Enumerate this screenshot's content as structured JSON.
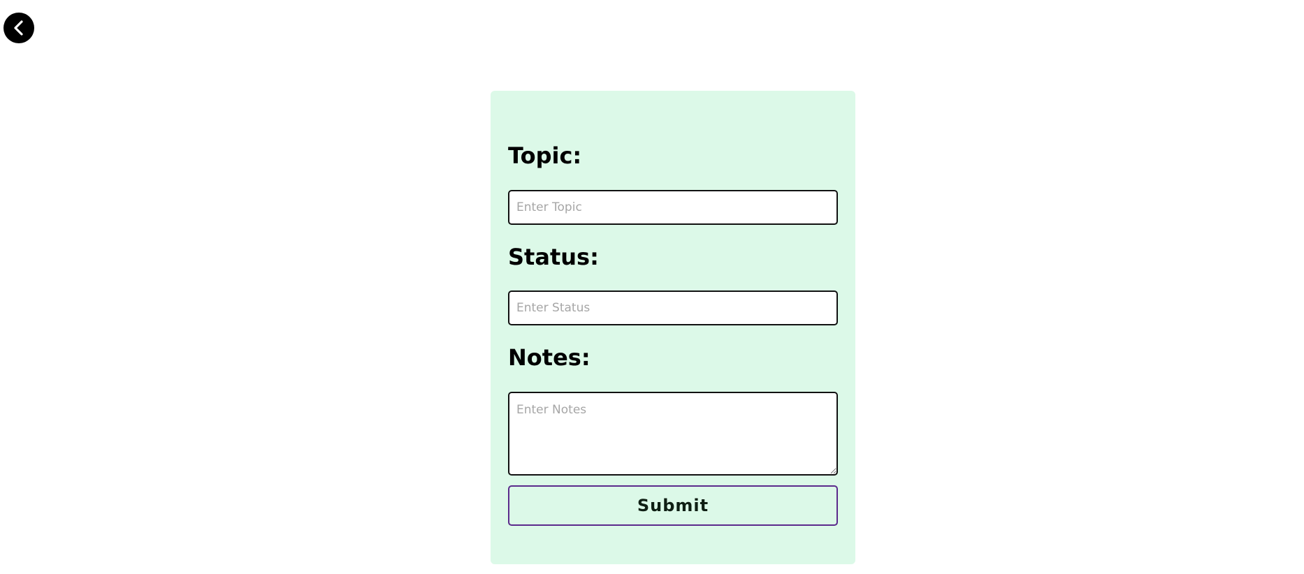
{
  "nav": {
    "back_icon": "chevron-left-icon"
  },
  "form": {
    "topic": {
      "label": "Topic:",
      "placeholder": "Enter Topic",
      "value": ""
    },
    "status": {
      "label": "Status:",
      "placeholder": "Enter Status",
      "value": ""
    },
    "notes": {
      "label": "Notes:",
      "placeholder": "Enter Notes",
      "value": ""
    },
    "submit_label": "Submit"
  },
  "colors": {
    "card_background": "#dcf9e8",
    "submit_border": "#5b2a8c",
    "input_border": "#111111"
  }
}
